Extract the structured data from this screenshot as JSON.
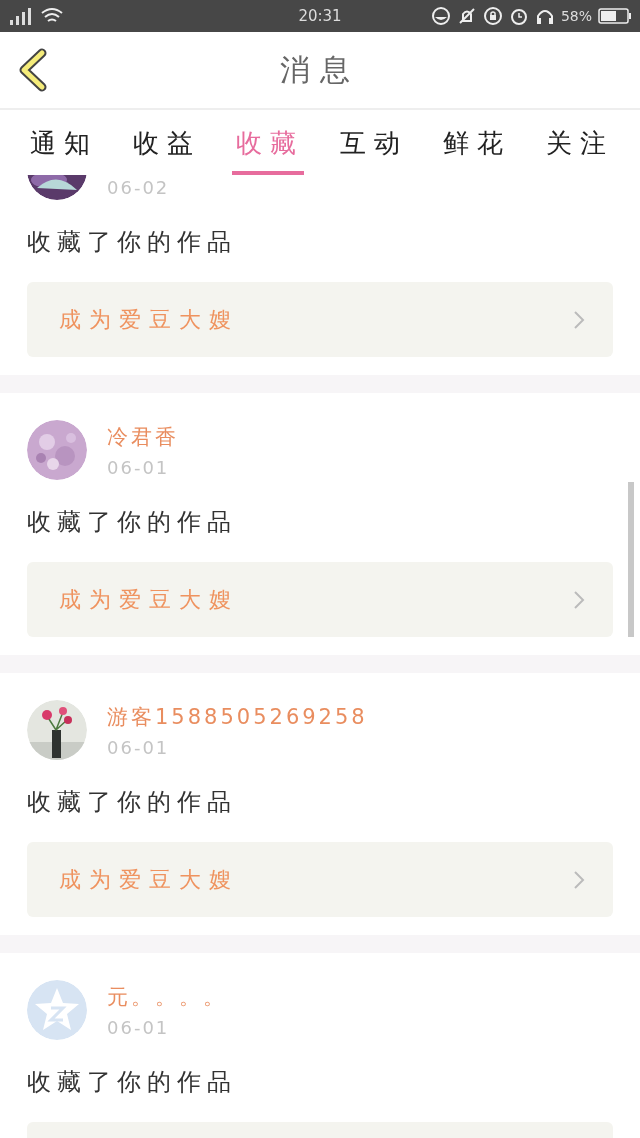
{
  "status_bar": {
    "time": "20:31",
    "battery_text": "58%"
  },
  "header": {
    "title": "消息"
  },
  "tabs": [
    {
      "label": "通知",
      "selected": false
    },
    {
      "label": "收益",
      "selected": false
    },
    {
      "label": "收藏",
      "selected": true
    },
    {
      "label": "互动",
      "selected": false
    },
    {
      "label": "鲜花",
      "selected": false
    },
    {
      "label": "关注",
      "selected": false
    }
  ],
  "messages": [
    {
      "date": "06-02",
      "text": "收藏了你的作品",
      "action": "成为爱豆大嫂"
    },
    {
      "name": "冷君香",
      "date": "06-01",
      "text": "收藏了你的作品",
      "action": "成为爱豆大嫂"
    },
    {
      "name": "游客1588505269258",
      "date": "06-01",
      "text": "收藏了你的作品",
      "action": "成为爱豆大嫂"
    },
    {
      "avatar": {
        "kind": "default"
      },
      "name": "元。。。。",
      "date": "06-01",
      "text": "收藏了你的作品"
    }
  ]
}
